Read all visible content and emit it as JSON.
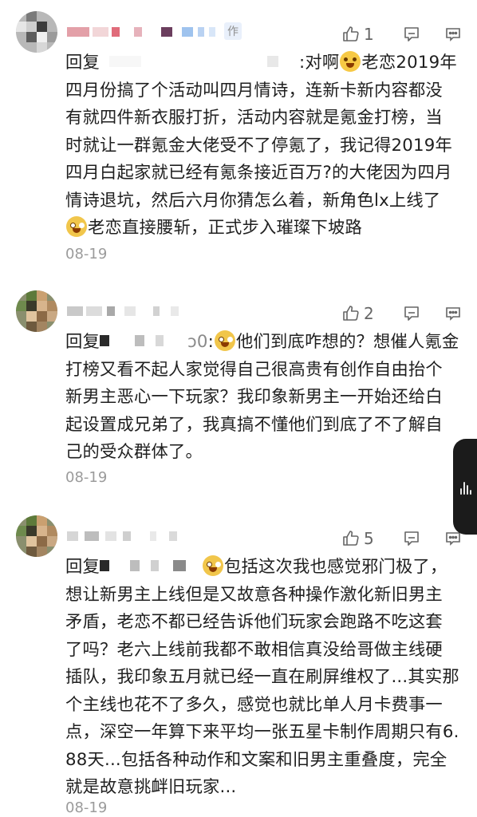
{
  "comments": [
    {
      "likes": "1",
      "tag": "作",
      "reply_prefix": "回复",
      "text_after_name": ":对啊",
      "text_main": "老恋2019年四月份搞了个活动叫四月情诗，连新卡新内容都没有就四件新衣服打折，活动内容就是氪金打榜，当时就让一群氪金大佬受不了停氪了，我记得2019年四月白起家就已经有氪条接近百万?的大佬因为四月情诗退坑，然后六月你猜怎么着，新角色lx上线了",
      "text_end": "老恋直接腰斩，正式步入璀璨下坡路",
      "date": "08-19"
    },
    {
      "likes": "2",
      "reply_prefix": "回复",
      "name_tail": "ɔ0",
      "text_after_name": ":",
      "text_main": "他们到底咋想的？想催人氪金打榜又看不起人家觉得自己很高贵有创作自由抬个新男主恶心一下玩家？我印象新男主一开始还给白起设置成兄弟了，我真搞不懂他们到底了不了解自己的受众群体了。",
      "date": "08-19"
    },
    {
      "likes": "5",
      "reply_prefix": "回复",
      "text_main": "包括这次我也感觉邪门极了，想让新男主上线但是又故意各种操作激化新旧男主矛盾，老恋不都已经告诉他们玩家会跑路不吃这套了吗？老六上线前我都不敢相信真没给哥做主线硬插队，我印象五月就已经一直在刷屏维权了...其实那个主线也花不了多久，感觉也就比单人月卡费事一点，深空一年算下来平均一张五星卡制作周期只有6.88天...包括各种动作和文案和旧男主重叠度，完全就是故意挑衅旧玩家...",
      "date": "08-19"
    }
  ],
  "colors": {
    "text": "#1f1f1f",
    "meta": "#9b9b9b",
    "icon": "#666666"
  },
  "icons": [
    "thumb-up-icon",
    "comment-icon",
    "more-icon",
    "voice-handle-icon"
  ]
}
